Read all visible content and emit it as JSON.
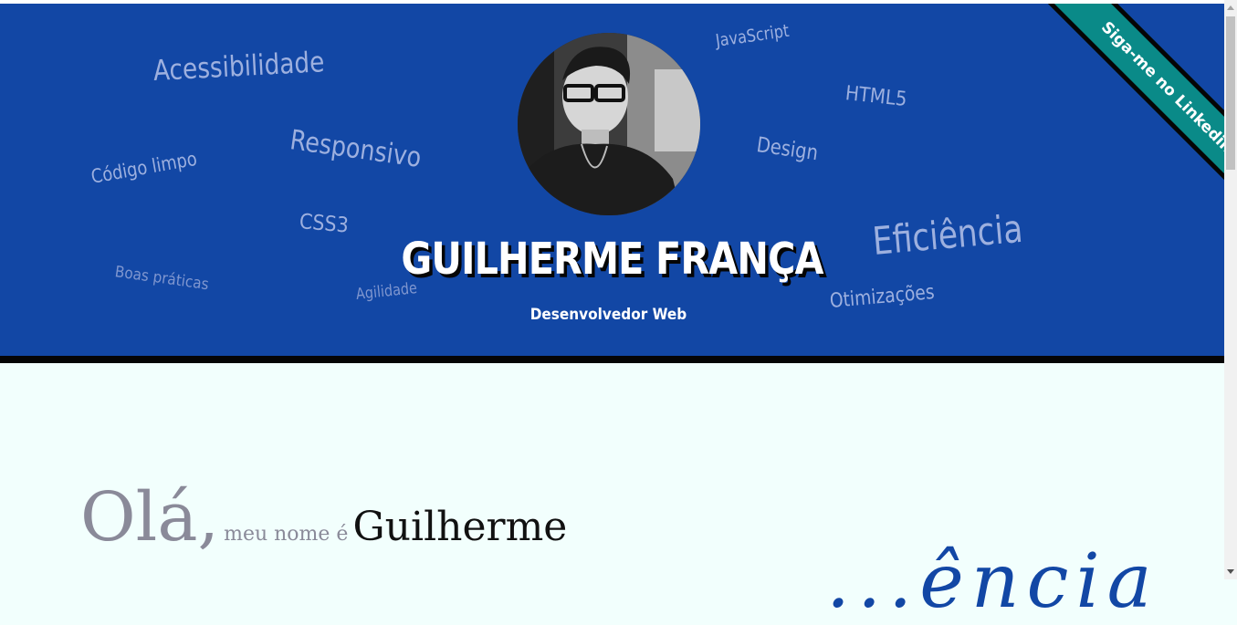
{
  "header": {
    "name": "GUILHERME FRANÇA",
    "role": "Desenvolvedor Web",
    "ribbon_label": "Siga-me no Linkedin",
    "colors": {
      "background": "#1247a5",
      "ribbon": "#0a8a88",
      "border": "#050505",
      "tag_text": "#9db0df"
    },
    "tags": {
      "acessibilidade": "Acessibilidade",
      "responsivo": "Responsivo",
      "codigo_limpo": "Código limpo",
      "css3": "CSS3",
      "boas_praticas": "Boas práticas",
      "agilidade": "Agilidade",
      "javascript": "JavaScript",
      "html5": "HTML5",
      "design": "Design",
      "eficiencia": "Eficiência",
      "otimizacoes": "Otimizações"
    }
  },
  "intro": {
    "greeting": "Olá,",
    "middle": "meu nome é",
    "first_name": "Guilherme",
    "partial_heading": "...ência"
  },
  "scrollbar": {
    "icon_up": "arrow-up-icon",
    "icon_down": "arrow-down-icon"
  }
}
